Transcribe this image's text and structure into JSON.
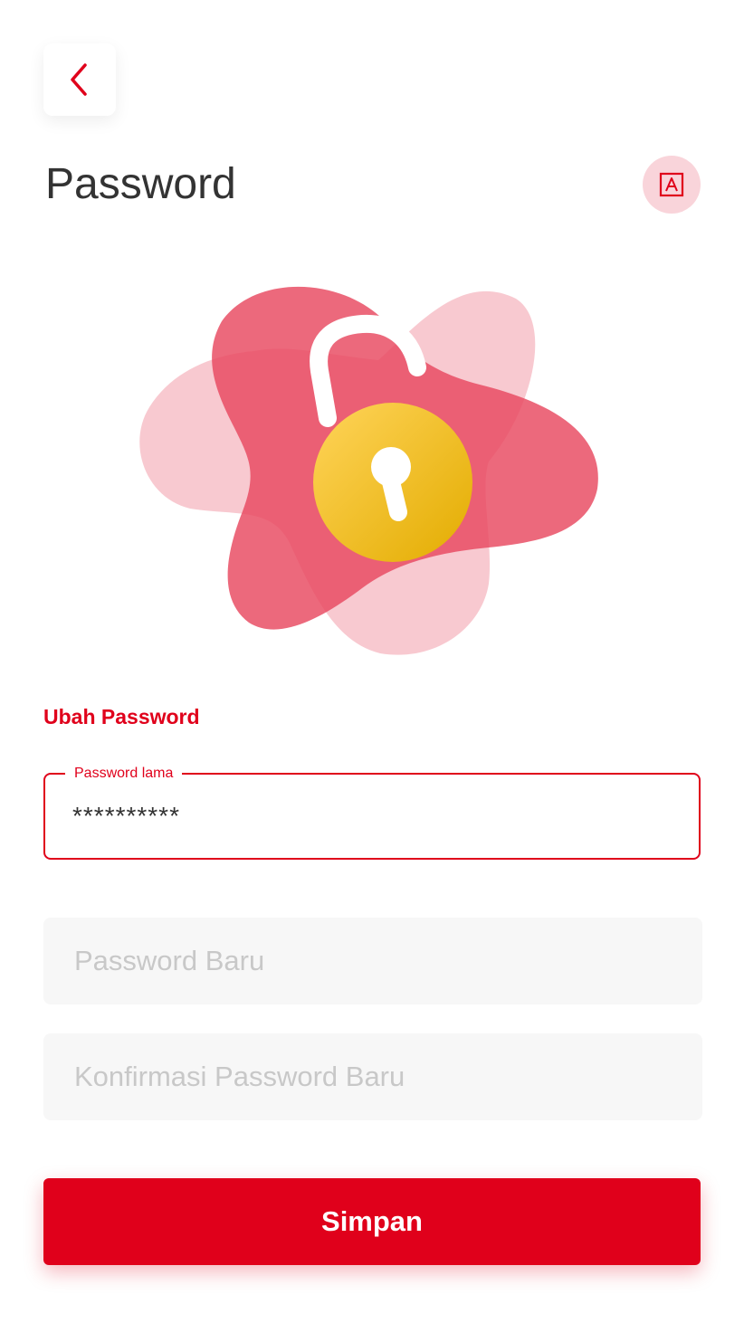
{
  "header": {
    "title": "Password",
    "back_icon": "chevron-left-icon",
    "language_icon": "translate-icon"
  },
  "illustration": {
    "icon": "unlocked-padlock-icon"
  },
  "form": {
    "section_title": "Ubah Password",
    "old_password": {
      "label": "Password lama",
      "value": "**********"
    },
    "new_password": {
      "placeholder": "Password Baru"
    },
    "confirm_password": {
      "placeholder": "Konfirmasi Password Baru"
    },
    "submit_label": "Simpan"
  },
  "colors": {
    "accent": "#e0001b",
    "blob_dark": "#e8485f",
    "blob_light": "#f7c3cb",
    "lock_gold": "#f2b90d",
    "field_bg": "#f7f7f7"
  }
}
